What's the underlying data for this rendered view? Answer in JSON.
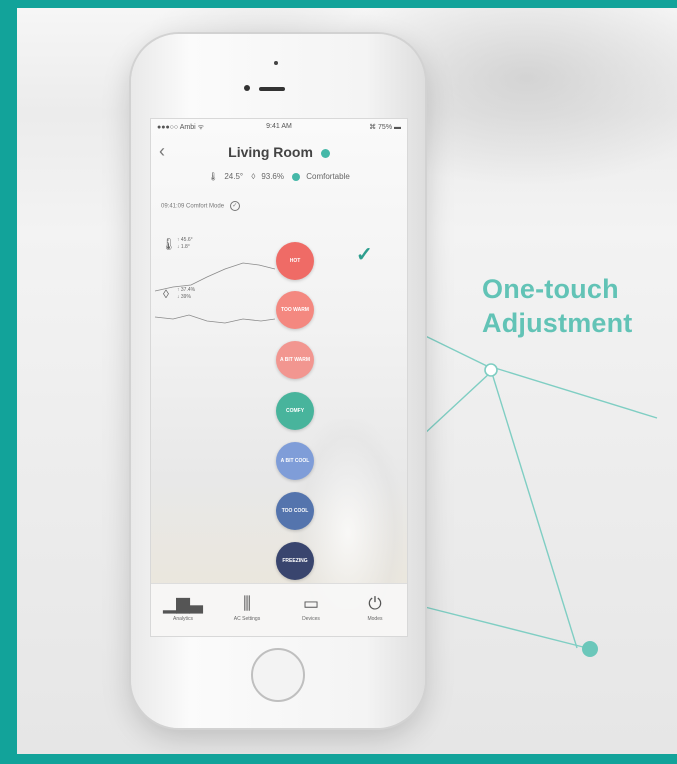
{
  "headline": {
    "line1": "One-touch",
    "line2": "Adjustment"
  },
  "colors": {
    "frame": "#12a39a",
    "accent": "#62c3b6",
    "hot": "#ef6b66",
    "too_warm": "#f48880",
    "a_bit_warm": "#f29690",
    "comfy": "#48b49c",
    "a_bit_cool": "#7f9dd8",
    "too_cool": "#5474ad",
    "freezing": "#39456e"
  },
  "phone": {
    "status": {
      "carrier": "●●●○○ Ambi ᯤ",
      "time": "9:41 AM",
      "battery": "⌘ 75% ▬"
    },
    "header": {
      "back_icon": "chevron-left-icon",
      "title": "Living Room"
    },
    "stats": {
      "temperature": "24.5°",
      "humidity": "93.6%",
      "comfort": "Comfortable"
    },
    "timeline": {
      "label": "09:41:09  Comfort Mode"
    },
    "mini_temp": {
      "line1": "↑ 45.6°",
      "line2": "↓ 1.8°"
    },
    "mini_hum": {
      "line1": "↑ 37.4%",
      "line2": "↓ 39%"
    },
    "modes": [
      {
        "label": "HOT"
      },
      {
        "label": "TOO WARM"
      },
      {
        "label": "A BIT WARM"
      },
      {
        "label": "COMFY"
      },
      {
        "label": "A BIT COOL"
      },
      {
        "label": "TOO COOL"
      },
      {
        "label": "FREEZING"
      }
    ],
    "tabs": [
      {
        "icon": "analytics-icon",
        "label": "Analytics"
      },
      {
        "icon": "ac-settings-icon",
        "label": "AC Settings"
      },
      {
        "icon": "devices-icon",
        "label": "Devices"
      },
      {
        "icon": "power-icon",
        "label": "Modes"
      }
    ]
  }
}
